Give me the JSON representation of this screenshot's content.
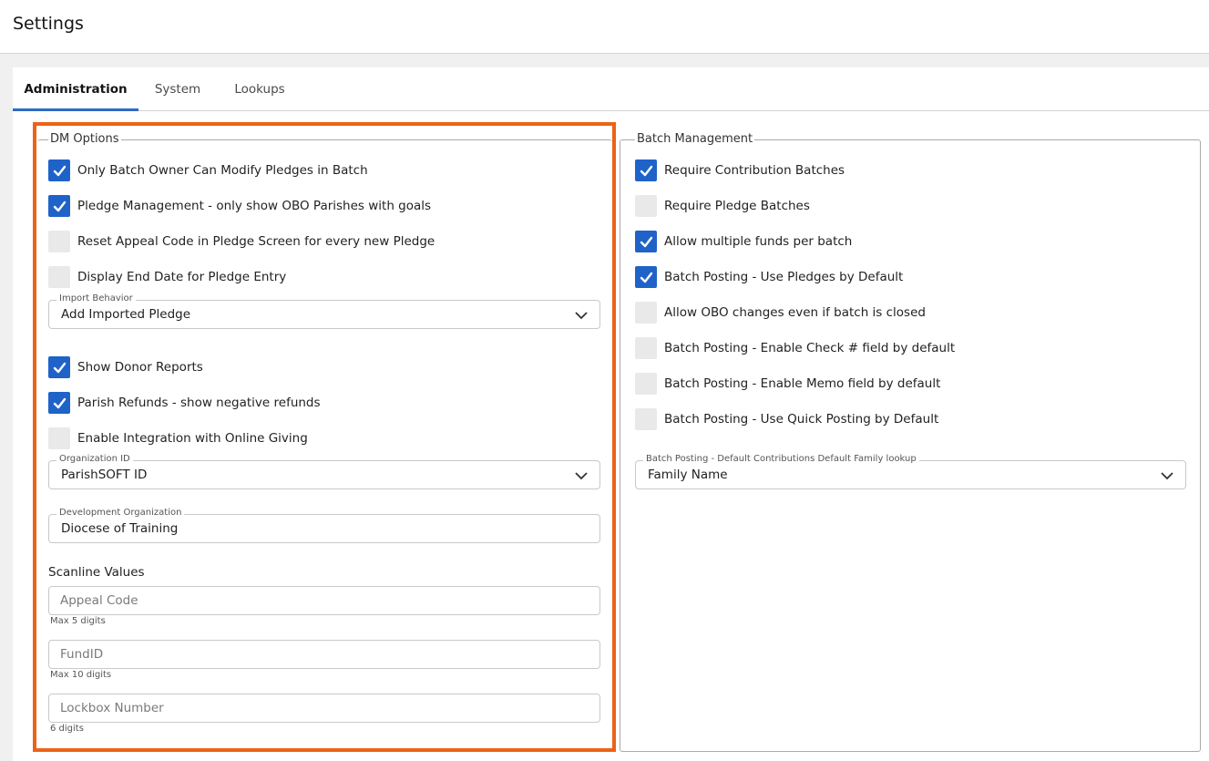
{
  "page": {
    "title": "Settings"
  },
  "tabs": [
    {
      "label": "Administration",
      "active": true
    },
    {
      "label": "System",
      "active": false
    },
    {
      "label": "Lookups",
      "active": false
    }
  ],
  "dm_options": {
    "legend": "DM Options",
    "checkboxes": [
      {
        "label": "Only Batch Owner Can Modify Pledges in Batch",
        "checked": true
      },
      {
        "label": "Pledge Management - only show OBO Parishes with goals",
        "checked": true
      },
      {
        "label": "Reset Appeal Code in Pledge Screen for every new Pledge",
        "checked": false
      },
      {
        "label": "Display End Date for Pledge Entry",
        "checked": false
      }
    ],
    "import_behavior": {
      "label": "Import Behavior",
      "value": "Add Imported Pledge"
    },
    "checkboxes2": [
      {
        "label": "Show Donor Reports",
        "checked": true
      },
      {
        "label": "Parish Refunds - show negative refunds",
        "checked": true
      },
      {
        "label": "Enable Integration with Online Giving",
        "checked": false
      }
    ],
    "organization_id": {
      "label": "Organization ID",
      "value": "ParishSOFT ID"
    },
    "development_org": {
      "label": "Development Organization",
      "value": "Diocese of Training"
    },
    "scanline": {
      "title": "Scanline Values",
      "appeal_code": {
        "placeholder": "Appeal Code",
        "helper": "Max 5 digits"
      },
      "fund_id": {
        "placeholder": "FundID",
        "helper": "Max 10 digits"
      },
      "lockbox": {
        "placeholder": "Lockbox Number",
        "helper": "6 digits"
      }
    }
  },
  "batch_management": {
    "legend": "Batch Management",
    "checkboxes": [
      {
        "label": "Require Contribution Batches",
        "checked": true
      },
      {
        "label": "Require Pledge Batches",
        "checked": false
      },
      {
        "label": "Allow multiple funds per batch",
        "checked": true
      },
      {
        "label": "Batch Posting - Use Pledges by Default",
        "checked": true
      },
      {
        "label": "Allow OBO changes even if batch is closed",
        "checked": false
      },
      {
        "label": "Batch Posting - Enable Check # field by default",
        "checked": false
      },
      {
        "label": "Batch Posting - Enable Memo field by default",
        "checked": false
      },
      {
        "label": "Batch Posting - Use Quick Posting by Default",
        "checked": false
      }
    ],
    "default_lookup": {
      "label": "Batch Posting - Default Contributions Default Family lookup",
      "value": "Family Name"
    }
  },
  "colors": {
    "accent": "#1f63c9",
    "highlight": "#ec6317",
    "tab_indicator": "#2b6cc4"
  }
}
